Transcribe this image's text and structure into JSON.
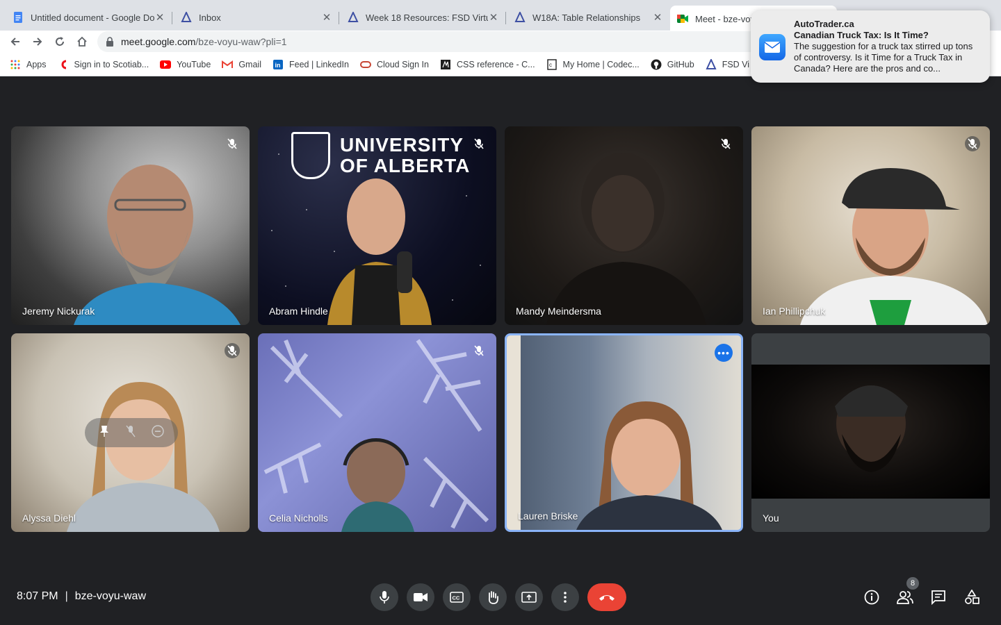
{
  "browser": {
    "tabs": [
      {
        "title": "Untitled document - Google Do",
        "icon": "google-docs-icon"
      },
      {
        "title": "Inbox",
        "icon": "eclass-icon"
      },
      {
        "title": "Week 18 Resources: FSD Virtu",
        "icon": "eclass-icon"
      },
      {
        "title": "W18A: Table Relationships",
        "icon": "eclass-icon"
      },
      {
        "title": "Meet - bze-voy",
        "icon": "google-meet-icon"
      }
    ],
    "url_host": "meet.google.com",
    "url_path": "/bze-voyu-waw?pli=1",
    "bookmarks": [
      {
        "label": "Apps",
        "icon": "apps-grid-icon"
      },
      {
        "label": "Sign in to Scotiab...",
        "icon": "scotiabank-icon"
      },
      {
        "label": "YouTube",
        "icon": "youtube-icon"
      },
      {
        "label": "Gmail",
        "icon": "gmail-icon"
      },
      {
        "label": "Feed | LinkedIn",
        "icon": "linkedin-icon"
      },
      {
        "label": "Cloud Sign In",
        "icon": "oracle-icon"
      },
      {
        "label": "CSS reference - C...",
        "icon": "codecademy-icon"
      },
      {
        "label": "My Home | Codec...",
        "icon": "codecademy-icon"
      },
      {
        "label": "GitHub",
        "icon": "github-icon"
      },
      {
        "label": "FSD Vi",
        "icon": "eclass-icon"
      }
    ]
  },
  "notification": {
    "app": "AutoTrader.ca",
    "title": "Canadian Truck Tax: Is It Time?",
    "body": "The suggestion for a truck tax stirred up tons of controversy. Is it Time for a Truck Tax in Canada? Here are the pros and co..."
  },
  "participants": [
    {
      "name": "Jeremy Nickurak",
      "muted": true
    },
    {
      "name": "Abram Hindle",
      "muted": true
    },
    {
      "name": "Mandy Meindersma",
      "muted": true
    },
    {
      "name": "Ian Phillipchuk",
      "muted": true
    },
    {
      "name": "Alyssa Diehl",
      "muted": true
    },
    {
      "name": "Celia Nicholls",
      "muted": true
    },
    {
      "name": "Lauren Briske",
      "muted": false
    },
    {
      "name": "You",
      "muted": false
    }
  ],
  "uofa_banner": {
    "line1": "UNIVERSITY",
    "line2": "OF ALBERTA"
  },
  "meeting": {
    "time": "8:07 PM",
    "code": "bze-voyu-waw",
    "participant_count": "8"
  },
  "colors": {
    "end_call": "#ea4335",
    "active_speaker_border": "#8ab4f8",
    "more_button": "#1a73e8"
  }
}
